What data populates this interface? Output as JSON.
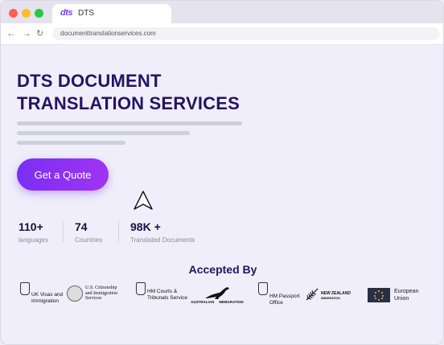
{
  "browser": {
    "tab_logo": "dts",
    "tab_title": "DTS",
    "url": "documenttranslationservices.com"
  },
  "hero": {
    "title_line1": "DTS DOCUMENT",
    "title_line2": "TRANSLATION SERVICES",
    "cta_label": "Get a Quote"
  },
  "stats": [
    {
      "value": "110+",
      "label": "languages"
    },
    {
      "value": "74",
      "label": "Countries"
    },
    {
      "value": "98K +",
      "label": "Translated Documents"
    }
  ],
  "accepted": {
    "heading": "Accepted By",
    "logos": [
      {
        "line1": "UK Visas and",
        "line2": "Immigration",
        "icon": "royal-crest-icon"
      },
      {
        "line1": "U.S. Citizenship",
        "line2": "and Immigration",
        "line3": "Services",
        "icon": "us-seal-icon"
      },
      {
        "line1": "HM Courts &",
        "line2": "Tribunals Service",
        "icon": "royal-crest-icon"
      },
      {
        "line1": "AUSTRALIAN",
        "line2": "IMMIGRATION",
        "icon": "kangaroo-icon"
      },
      {
        "line1": "HM Passport",
        "line2": "Office",
        "icon": "royal-crest-icon"
      },
      {
        "line1": "NEW ZEALAND",
        "line2": "IMMIGRATION",
        "icon": "fern-icon"
      },
      {
        "line1": "European",
        "line2": "Union",
        "icon": "eu-flag-icon"
      }
    ]
  },
  "colors": {
    "accent": "#7a2ff5",
    "heading": "#241463",
    "background": "#efeefa"
  }
}
